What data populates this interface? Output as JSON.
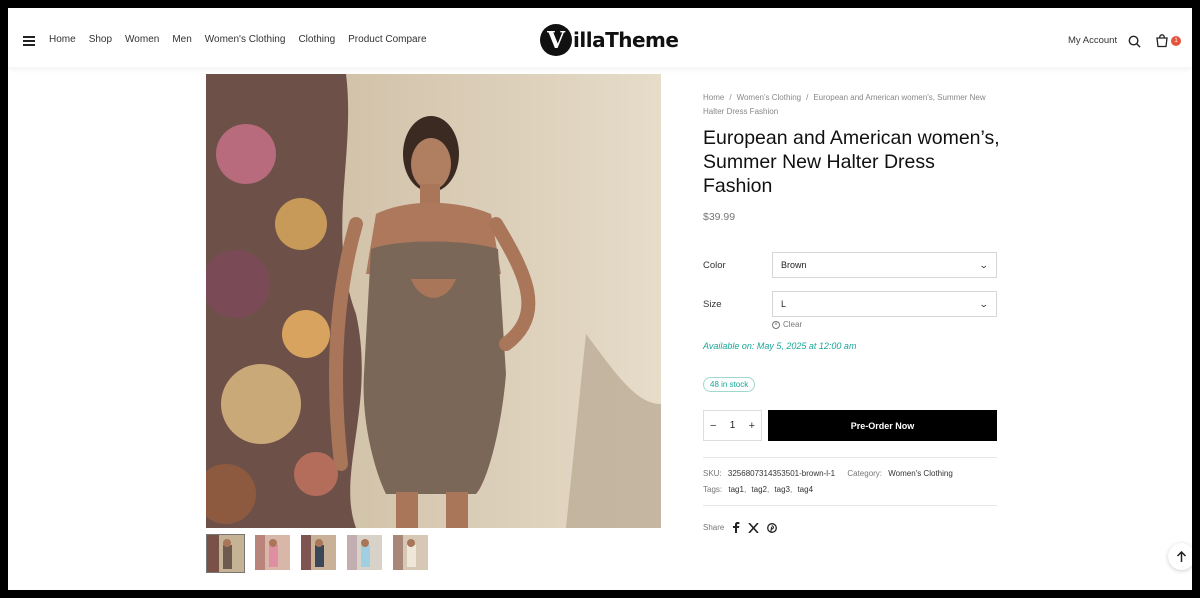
{
  "header": {
    "nav": [
      "Home",
      "Shop",
      "Women",
      "Men",
      "Women's Clothing",
      "Clothing",
      "Product Compare"
    ],
    "logo_letter": "V",
    "logo_text": "illaTheme",
    "account": "My Account",
    "cart_count": "1"
  },
  "breadcrumb": {
    "home": "Home",
    "category": "Women's Clothing",
    "current": "European and American women's, Summer New Halter Dress Fashion",
    "separator": "/"
  },
  "product": {
    "title": "European and American women’s, Summer New Halter Dress Fashion",
    "price": "$39.99",
    "color_label": "Color",
    "color_value": "Brown",
    "size_label": "Size",
    "size_value": "L",
    "clear_label": "Clear",
    "available": "Available on: May 5, 2025 at 12:00 am",
    "stock": "48 in stock",
    "quantity": "1",
    "preorder_label": "Pre-Order Now"
  },
  "meta": {
    "sku_label": "SKU:",
    "sku": "3256807314353501-brown-l-1",
    "category_label": "Category:",
    "category": "Women's Clothing",
    "tags_label": "Tags:",
    "tags": [
      "tag1",
      "tag2",
      "tag3",
      "tag4"
    ],
    "share_label": "Share"
  },
  "colors": {
    "accent": "#1aa79a",
    "badge": "#e5533c",
    "button": "#000000"
  }
}
